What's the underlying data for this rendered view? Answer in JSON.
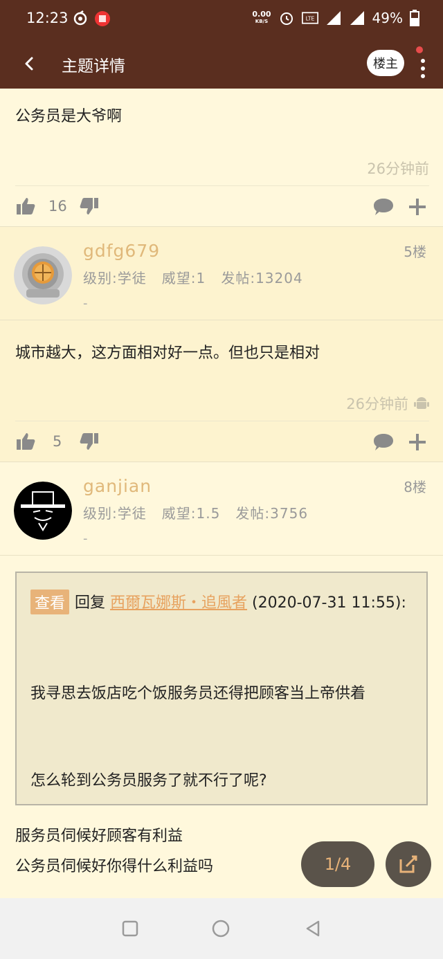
{
  "status_bar": {
    "time": "12:23",
    "net_speed": "0.00",
    "net_unit": "KB/S",
    "network": "4G",
    "battery": "49%"
  },
  "app_bar": {
    "title": "主题详情",
    "owner_button": "楼主"
  },
  "post_top": {
    "text": "公务员是大爷啊",
    "time": "26分钟前",
    "likes": "16"
  },
  "post_5": {
    "username": "gdfg679",
    "meta": "级别:学徒   威望:1   发帖:13204",
    "signature": "-",
    "floor": "5楼",
    "text": "城市越大，这方面相对好一点。但也只是相对",
    "time": "26分钟前",
    "likes": "5"
  },
  "post_8": {
    "username": "ganjian",
    "meta": "级别:学徒   威望:1.5   发帖:3756",
    "signature": "-",
    "floor": "8楼",
    "quote": {
      "view_label": "查看",
      "reply_label": "回复",
      "author": "西爾瓦娜斯・追風者",
      "date": "(2020-07-31 11:55):",
      "line1": "我寻思去饭店吃个饭服务员还得把顾客当上帝供着",
      "line2": "怎么轮到公务员服务了就不行了呢?"
    },
    "reply_line1": "服务员伺候好顾客有利益",
    "reply_line2": "公务员伺候好你得什么利益吗"
  },
  "pager": "1/4",
  "colors": {
    "header": "#5a2e1f",
    "background": "#fff8dc",
    "accent": "#e8b379"
  }
}
